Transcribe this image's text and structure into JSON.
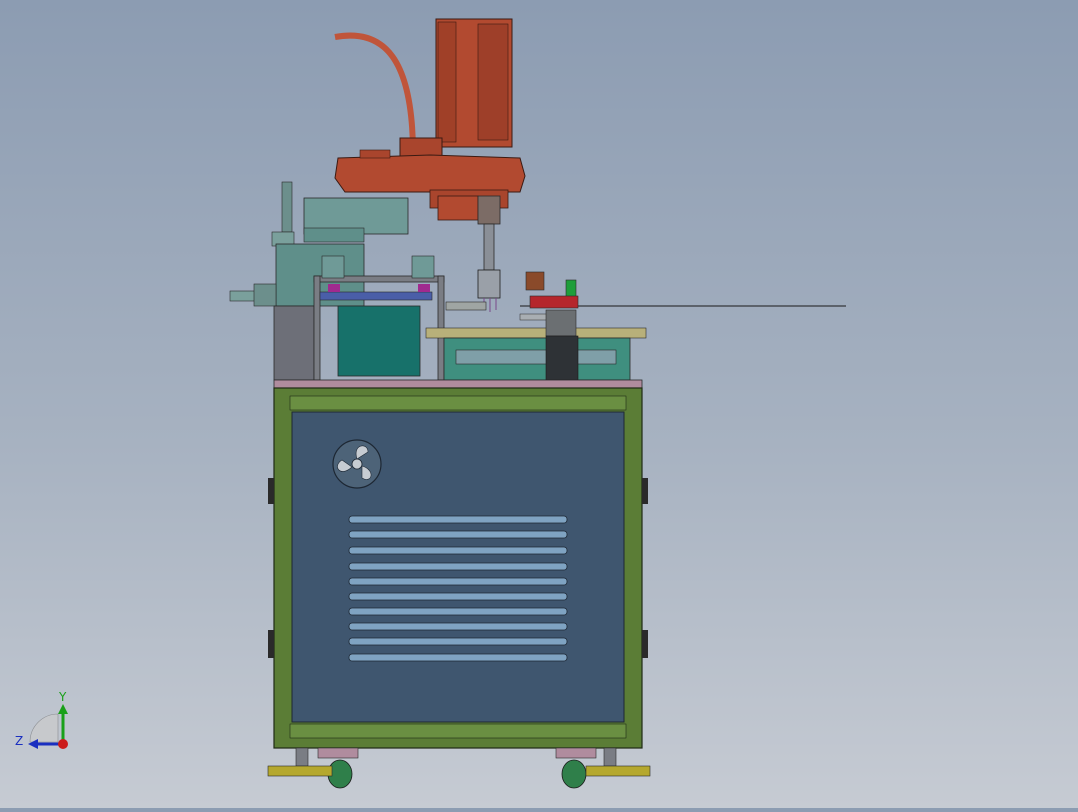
{
  "view": {
    "background_top": "#8c9cb2",
    "background_bottom": "#c6cbd3"
  },
  "model": {
    "parts": [
      {
        "name": "scara-robot",
        "color": "#b24a30"
      },
      {
        "name": "robot-cable",
        "color": "#c0553a"
      },
      {
        "name": "servo-motor-unit",
        "color": "#5f8f8a"
      },
      {
        "name": "feeder-frame",
        "color": "#7a7d84"
      },
      {
        "name": "teal-block",
        "color": "#17716a"
      },
      {
        "name": "linear-slide",
        "color": "#3f8f7f"
      },
      {
        "name": "workpiece-fixture",
        "color": "#b5262c"
      },
      {
        "name": "cabinet-frame",
        "color": "#5b7d36"
      },
      {
        "name": "cabinet-panel",
        "color": "#3f566f"
      },
      {
        "name": "cooling-fan",
        "color": "#4d6378"
      },
      {
        "name": "vent-louvers",
        "color": "#5d7f9e"
      },
      {
        "name": "casters",
        "color": "#2f7f4a"
      },
      {
        "name": "leveling-feet",
        "color": "#b5a82e"
      }
    ]
  },
  "triad": {
    "y_label": "Y",
    "z_label": "Z",
    "y_color": "#19a019",
    "z_color": "#1a2fc0",
    "x_color": "#cc1b1b"
  }
}
